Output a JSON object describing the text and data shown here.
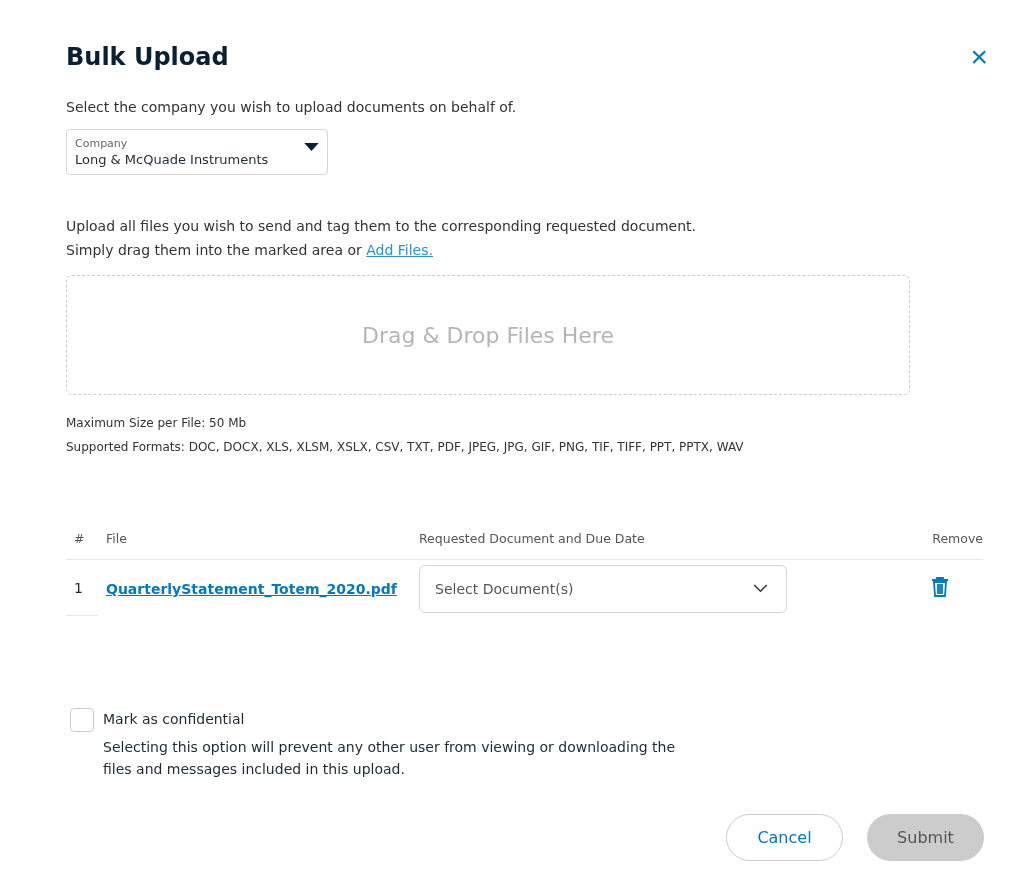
{
  "dialog": {
    "title": "Bulk Upload",
    "close": "×"
  },
  "company_prompt": "Select the company you wish to upload documents on behalf of.",
  "company_select": {
    "label": "Company",
    "value": "Long & McQuade Instruments"
  },
  "upload_intro": {
    "line_1": "Upload all files you wish to send and tag them to the corresponding requested document.",
    "line_2": "Simply drag them into the marked area or ",
    "link": "Add Files."
  },
  "drop_zone": {
    "text": "Drag & Drop Files Here"
  },
  "limits": [
    "Maximum Size per File: 50 Mb",
    "Supported Formats: DOC, DOCX, XLS, XLSM, XSLX, CSV, TXT, PDF, JPEG, JPG, GIF, PNG, TIF, TIFF, PPT, PPTX, WAV"
  ],
  "table": {
    "columns": [
      "#",
      "File",
      "Requested Document and Due Date",
      "Remove"
    ],
    "rows": [
      {
        "number": "1",
        "file": "QuarterlyStatement_Totem_2020.pdf",
        "document_select": {
          "placeholder": "Select Document(s)"
        }
      }
    ]
  },
  "confidential": {
    "label": "Mark as confidential",
    "checked": false,
    "description": "Selecting this option will prevent any other user from viewing or downloading the files and messages included in this upload."
  },
  "buttons": [
    {
      "label": "Cancel",
      "kind": "secondary",
      "disabled": false
    },
    {
      "label": "Submit",
      "kind": "primary",
      "disabled": true
    }
  ]
}
